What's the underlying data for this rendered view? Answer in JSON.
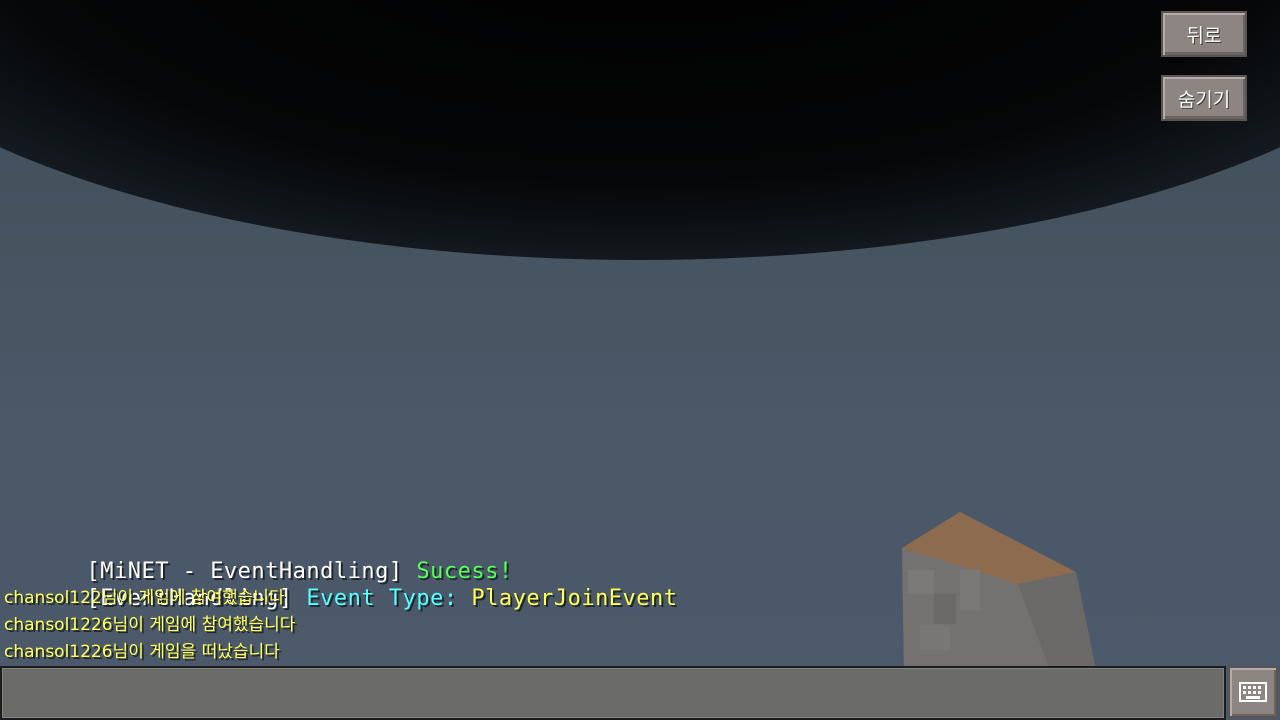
{
  "hud": {
    "back_label": "뒤로",
    "hide_label": "숨기기"
  },
  "chat": {
    "lines": [
      {
        "segments": [
          {
            "text": "[MiNET - EventHandling] ",
            "color": "#ffffff"
          },
          {
            "text": "Sucess!",
            "color": "#55ff55"
          }
        ]
      },
      {
        "segments": [
          {
            "text": "[EventHandling] ",
            "color": "#ffffff"
          },
          {
            "text": "Event Type: ",
            "color": "#55ffff"
          },
          {
            "text": "PlayerJoinEvent",
            "color": "#ffff55"
          }
        ]
      },
      {
        "text": "chansol122님이 게임에 참여했습니다",
        "color": "#ffff55"
      },
      {
        "text": "chansol1226님이 게임에 참여했습니다",
        "color": "#ffff55"
      },
      {
        "text": "chansol1226님이 게임을 떠났습니다",
        "color": "#ffff55"
      }
    ]
  },
  "input": {
    "value": "",
    "placeholder": ""
  },
  "icons": {
    "keyboard": "keyboard-icon"
  },
  "colors": {
    "sky": "#4a5868",
    "button": "#8c8582",
    "input_bar": "#6b6b6a"
  }
}
